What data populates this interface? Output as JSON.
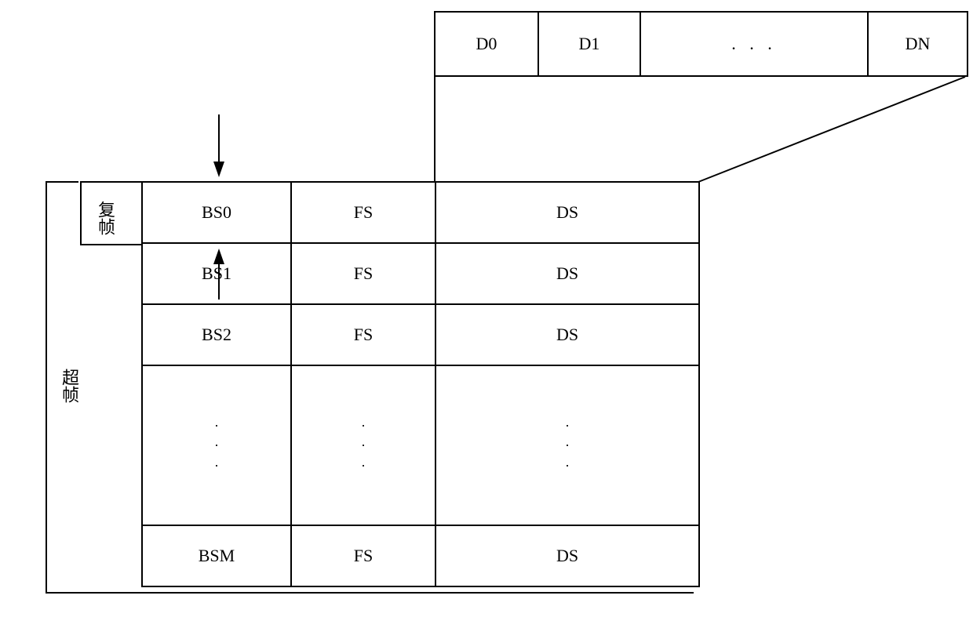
{
  "detail": {
    "d0": "D0",
    "d1": "D1",
    "ellipsis": ". . .",
    "dn": "DN"
  },
  "labels": {
    "multiframe": "复帧",
    "superframe": "超帧"
  },
  "rows": [
    {
      "bs": "BS0",
      "fs": "FS",
      "ds": "DS"
    },
    {
      "bs": "BS1",
      "fs": "FS",
      "ds": "DS"
    },
    {
      "bs": "BS2",
      "fs": "FS",
      "ds": "DS"
    },
    {
      "bs": "",
      "fs": "",
      "ds": "",
      "tall": true,
      "vdots": true
    },
    {
      "bs": "BSM",
      "fs": "FS",
      "ds": "DS"
    }
  ],
  "vdots_glyph": "·\n·\n·"
}
